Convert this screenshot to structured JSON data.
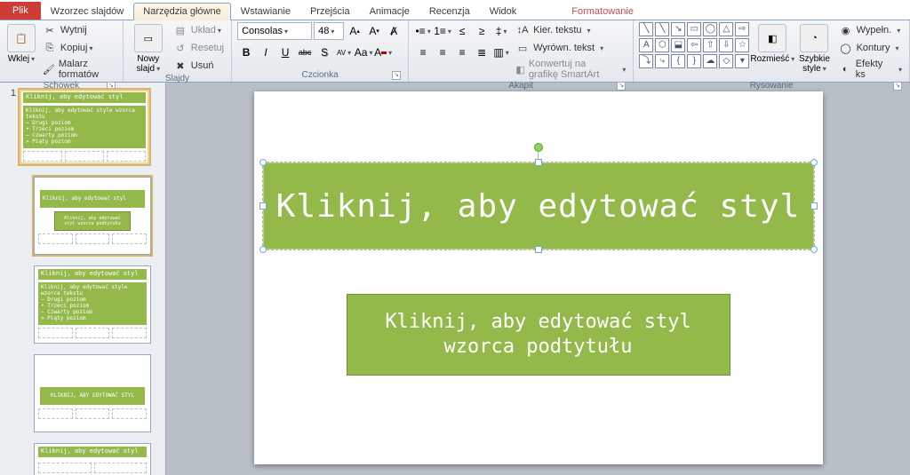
{
  "tabs": {
    "file": "Plik",
    "items": [
      "Wzorzec slajdów",
      "Narzędzia główne",
      "Wstawianie",
      "Przejścia",
      "Animacje",
      "Recenzja",
      "Widok"
    ],
    "context": "Formatowanie",
    "active": "Narzędzia główne"
  },
  "ribbon": {
    "clipboard": {
      "paste": "Wklej",
      "cut": "Wytnij",
      "copy": "Kopiuj",
      "format_painter": "Malarz formatów",
      "label": "Schowek"
    },
    "slides": {
      "new_slide": "Nowy\nslajd",
      "layout": "Układ",
      "reset": "Resetuj",
      "delete": "Usuń",
      "label": "Slajdy"
    },
    "font": {
      "name": "Consolas",
      "size": "48",
      "label": "Czcionka",
      "grow": " ",
      "shrink": " ",
      "clear": " ",
      "bold": "B",
      "italic": "I",
      "underline": "U",
      "strike": "abc",
      "shadow": "S",
      "spacing": "AV",
      "case": "Aa",
      "font_color_swatch": "#c00000",
      "highlight_swatch": "#ffff00"
    },
    "para": {
      "label": "Akapit",
      "direction": "Kier. tekstu",
      "align": "Wyrówn. tekst",
      "smartart": "Konwertuj na grafikę SmartArt"
    },
    "drawing": {
      "label": "Rysowanie",
      "arrange": "Rozmieść",
      "quick_styles": "Szybkie\nstyle",
      "fill": "Wypełn.",
      "outline": "Kontury",
      "effects": "Efekty ks"
    }
  },
  "thumbs": {
    "index": "1",
    "master_title": "Kliknij, aby edytować styl",
    "master_body": "Kliknij, aby edytować style wzorca tekstu\n – Drugi poziom\n    • Trzeci poziom\n       – Czwarty poziom\n          » Piąty poziom",
    "layout_title_small": "Kliknij, aby edytować styl",
    "layout_sub_small": "Kliknij, aby edytować styl wzorca podtytułu",
    "layout4_title": "KLIKNIJ, ABY EDYTOWAĆ STYL"
  },
  "canvas": {
    "title_text": "Kliknij, aby edytować styl",
    "subtitle_text": "Kliknij, aby edytować styl\nwzorca podtytułu"
  }
}
